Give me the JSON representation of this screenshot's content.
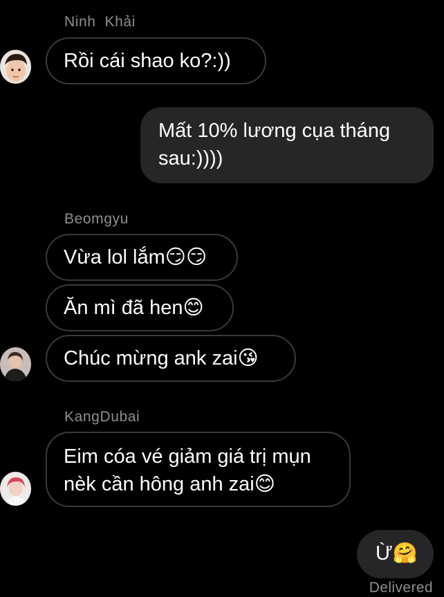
{
  "conversation": {
    "group1": {
      "sender": "Ninh  Khải",
      "messages": [
        "Rồi cái shao ko?:))"
      ]
    },
    "outgoing1": {
      "text": "Mất 10% lương cụa tháng sau:))))"
    },
    "group2": {
      "sender": "Beomgyu",
      "messages": [
        "Vừa lol lắm😏😏",
        "Ăn mì đã hen😊",
        "Chúc mừng ank zai😘"
      ]
    },
    "group3": {
      "sender": "KangDubai",
      "messages": [
        "Eim cóa vé giảm giá trị mụn nèk cần hông anh zai😊"
      ]
    },
    "outgoing2": {
      "text": "Ừ🤗"
    },
    "status": "Delivered"
  },
  "colors": {
    "background": "#000000",
    "incoming_bubble_border": "#3a3a3c",
    "outgoing_bubble": "#262628",
    "sender_name": "#8e8e93",
    "text": "#ffffff"
  },
  "icons": {
    "avatars": [
      "ninh-khai-avatar",
      "beomgyu-avatar",
      "kangdubai-avatar"
    ]
  }
}
